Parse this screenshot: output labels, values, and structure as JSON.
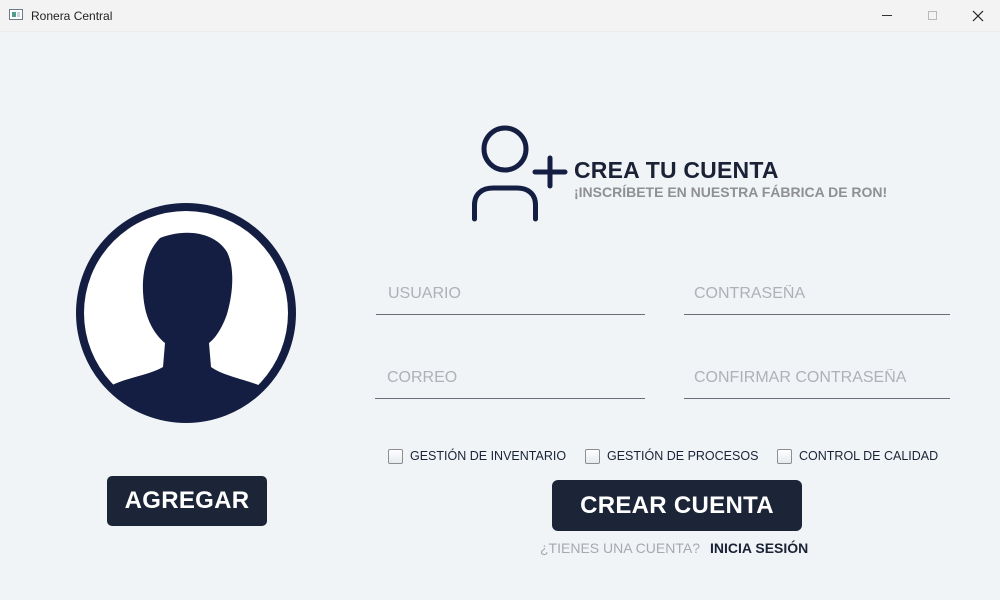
{
  "window": {
    "title": "Ronera Central",
    "icon": "app-window-icon"
  },
  "colors": {
    "primary": "#1c2438",
    "background": "#f0f4f7",
    "muted": "#8f8f94"
  },
  "avatar": {
    "icon": "user-avatar-icon"
  },
  "agregar_label": "AGREGAR",
  "header": {
    "icon": "add-user-icon",
    "title": "CREA TU CUENTA",
    "subtitle": "¡INSCRÍBETE EN NUESTRA FÁBRICA DE RON!"
  },
  "form": {
    "usuario_placeholder": "USUARIO",
    "usuario_value": "",
    "contrasena_placeholder": "CONTRASEÑA",
    "contrasena_value": "",
    "correo_placeholder": "CORREO",
    "correo_value": "",
    "confirmar_placeholder": "CONFIRMAR CONTRASEÑA",
    "confirmar_value": ""
  },
  "permissions": [
    {
      "label": "GESTIÓN DE INVENTARIO",
      "checked": false
    },
    {
      "label": "GESTIÓN DE PROCESOS",
      "checked": false
    },
    {
      "label": "CONTROL DE CALIDAD",
      "checked": false
    }
  ],
  "submit_label": "CREAR CUENTA",
  "footer": {
    "question": "¿TIENES UNA CUENTA?",
    "link": "INICIA SESIÓN"
  }
}
